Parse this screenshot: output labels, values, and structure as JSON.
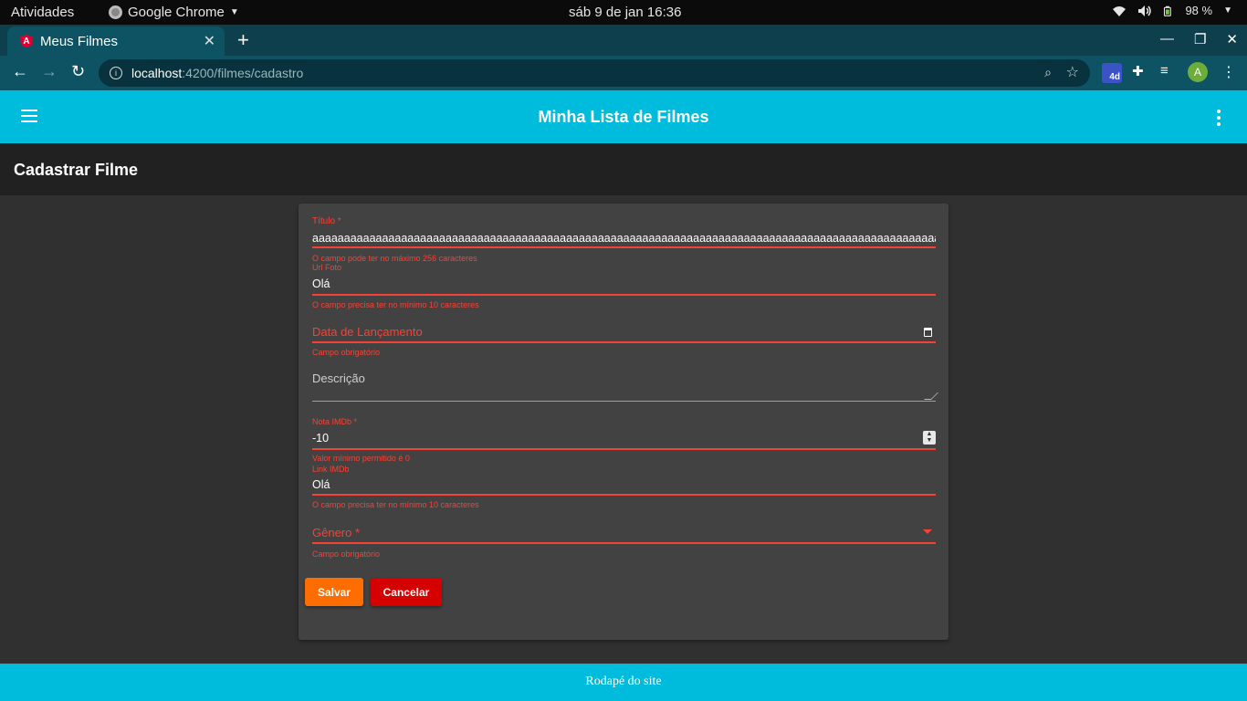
{
  "desktop": {
    "activities": "Atividades",
    "app_name": "Google Chrome",
    "clock": "sáb 9 de jan  16:36",
    "battery": "98 %"
  },
  "browser": {
    "tab_title": "Meus Filmes",
    "url_host": "localhost",
    "url_path": ":4200/filmes/cadastro",
    "profile_initial": "A",
    "extension_badge": "4d"
  },
  "app": {
    "title": "Minha Lista de Filmes",
    "page_title": "Cadastrar Filme",
    "footer": "Rodapé do site"
  },
  "form": {
    "titulo": {
      "label": "Título *",
      "value": "aaaaaaaaaaaaaaaaaaaaaaaaaaaaaaaaaaaaaaaaaaaaaaaaaaaaaaaaaaaaaaaaaaaaaaaaaaaaaaaaaaaaaaaaaaaaaaaaaaaaaaaaaaaaaaaaaaaa",
      "error": "O campo pode ter no máximo 256 caracteres"
    },
    "url_foto": {
      "label": "Url Foto",
      "value": "Olá",
      "error": "O campo precisa ter no mínimo 10 caracteres"
    },
    "data_lancamento": {
      "placeholder": "Data de Lançamento",
      "error": "Campo obrigatório"
    },
    "descricao": {
      "label": "Descrição"
    },
    "nota_imdb": {
      "label": "Nota IMDb *",
      "value": "-10",
      "error": "Valor mínimo permitido é 0"
    },
    "link_imdb": {
      "label": "Link IMDb",
      "value": "Olá",
      "error": "O campo precisa ter no mínimo 10 caracteres"
    },
    "genero": {
      "placeholder": "Gênero *",
      "error": "Campo obrigatório"
    },
    "save_label": "Salvar",
    "cancel_label": "Cancelar"
  },
  "colors": {
    "header": "#00bcdc",
    "error": "#f44336",
    "save": "#ff6d00",
    "cancel": "#d50000"
  }
}
